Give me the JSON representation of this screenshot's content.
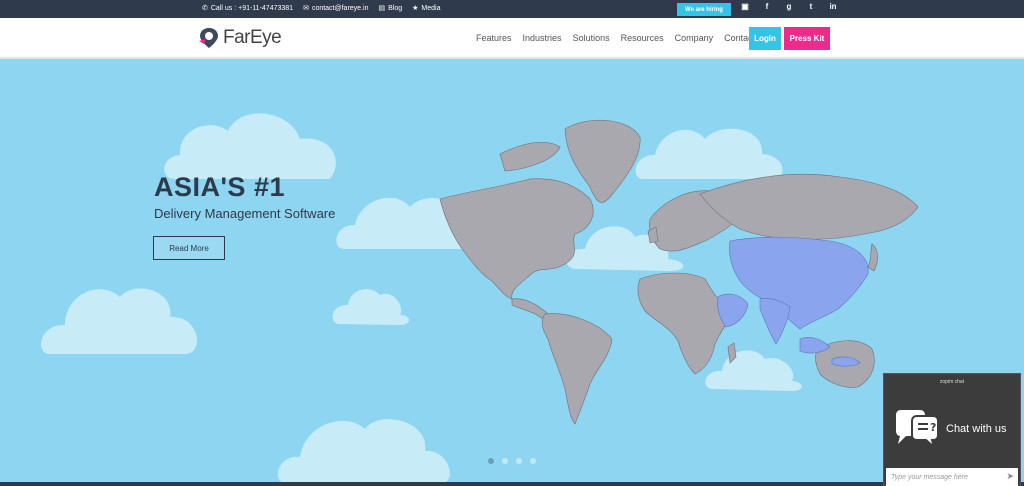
{
  "topbar": {
    "phone": "Call us : +91-11-47473381",
    "email": "contact@fareye.in",
    "blog": "Blog",
    "media": "Media",
    "hiring": "We are hiring",
    "social": [
      {
        "name": "foursquare-icon",
        "glyph": "▣"
      },
      {
        "name": "facebook-icon",
        "glyph": "f"
      },
      {
        "name": "google-plus-icon",
        "glyph": "g"
      },
      {
        "name": "twitter-icon",
        "glyph": "t"
      },
      {
        "name": "linkedin-icon",
        "glyph": "in"
      }
    ]
  },
  "navbar": {
    "logo": "FarEye",
    "items": [
      "Features",
      "Industries",
      "Solutions",
      "Resources",
      "Company",
      "Contact"
    ],
    "login": "Login",
    "press_kit": "Press Kit"
  },
  "hero": {
    "title": "ASIA'S #1",
    "subtitle": "Delivery Management Software",
    "button": "Read More",
    "slides": 4,
    "active_slide": 0
  },
  "chat": {
    "brand": "zopim chat",
    "label": "Chat with us",
    "placeholder": "Type your message here"
  },
  "colors": {
    "sky": "#8dd5f1",
    "land": "#a8a8ae",
    "asia": "#8aa5ee",
    "cloud": "#c7ecf8",
    "accent": "#36c4e6",
    "pink": "#ec2b8b",
    "dark": "#2f3b4c"
  }
}
